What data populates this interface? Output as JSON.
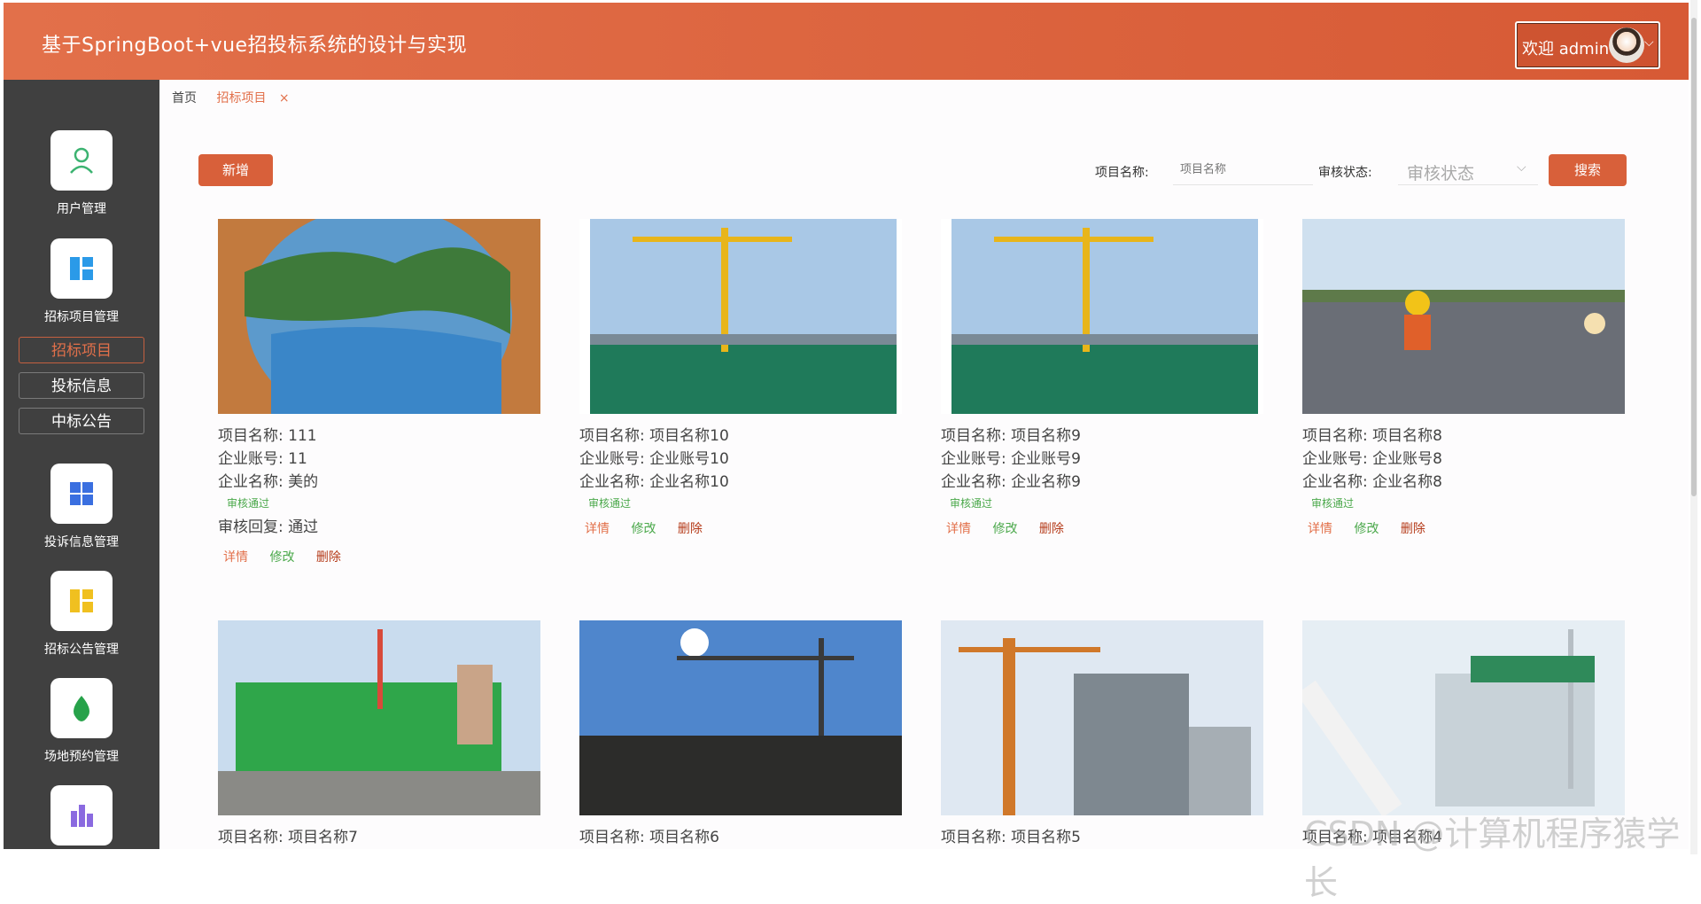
{
  "header": {
    "title": "基于SpringBoot+vue招投标系统的设计与实现",
    "welcome": "欢迎 admin"
  },
  "sidebar": {
    "groups": [
      {
        "label": "用户管理",
        "icon": "user-icon",
        "color": "#3cb371"
      },
      {
        "label": "招标项目管理",
        "icon": "dashboard-icon",
        "color": "#2b9ae8"
      },
      {
        "label": "投诉信息管理",
        "icon": "grid-icon",
        "color": "#3a6fe0"
      },
      {
        "label": "招标公告管理",
        "icon": "dashboard-icon",
        "color": "#f0c020"
      },
      {
        "label": "场地预约管理",
        "icon": "leaf-icon",
        "color": "#27a24a"
      },
      {
        "label": "",
        "icon": "buildings-icon",
        "color": "#8a6ae0"
      }
    ],
    "subitems": [
      "招标项目",
      "投标信息",
      "中标公告"
    ]
  },
  "breadcrumb": {
    "home": "首页",
    "current": "招标项目",
    "close": "×"
  },
  "toolbar": {
    "add_label": "新增",
    "name_label": "项目名称:",
    "name_placeholder": "项目名称",
    "status_label": "审核状态:",
    "status_placeholder": "审核状态",
    "search_label": "搜索"
  },
  "labels": {
    "project_name": "项目名称:",
    "company_account": "企业账号:",
    "company_name": "企业名称:",
    "reply": "审核回复:",
    "detail": "详情",
    "edit": "修改",
    "delete": "删除"
  },
  "cards": [
    {
      "name": "111",
      "account": "11",
      "company": "美的",
      "status": "审核通过",
      "reply": "通过",
      "image": "lake-poster"
    },
    {
      "name": "项目名称10",
      "account": "企业账号10",
      "company": "企业名称10",
      "status": "审核通过",
      "image": "crane-site"
    },
    {
      "name": "项目名称9",
      "account": "企业账号9",
      "company": "企业名称9",
      "status": "审核通过",
      "image": "crane-site"
    },
    {
      "name": "项目名称8",
      "account": "企业账号8",
      "company": "企业名称8",
      "status": "审核通过",
      "image": "workers-rebar"
    },
    {
      "name": "项目名称7",
      "image": "green-scaffold"
    },
    {
      "name": "项目名称6",
      "image": "sunny-crane"
    },
    {
      "name": "项目名称5",
      "image": "steel-frame"
    },
    {
      "name": "项目名称4",
      "image": "substation"
    }
  ],
  "watermark": "CSDN @计算机程序猿学长",
  "colors": {
    "header": "#e2704a",
    "sidebar": "#404040",
    "accent": "#d8603a",
    "status_green": "#4aa84a"
  }
}
